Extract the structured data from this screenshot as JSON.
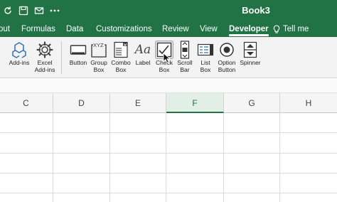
{
  "window": {
    "title": "Book3"
  },
  "menu": {
    "tabs": [
      "out",
      "Formulas",
      "Data",
      "Customizations",
      "Review",
      "View",
      "Developer"
    ],
    "active": "Developer",
    "tell_me": "Tell me"
  },
  "ribbon": {
    "addins": {
      "label": "Add-ins"
    },
    "excel_addins": {
      "label": "Excel\nAdd-ins"
    },
    "button": {
      "label": "Button"
    },
    "group_box": {
      "label": "Group\nBox",
      "icon_text": "XYZ"
    },
    "combo_box": {
      "label": "Combo\nBox"
    },
    "label": {
      "label": "Label",
      "icon_text": "Aa"
    },
    "check_box": {
      "label": "Check\nBox"
    },
    "scroll_bar": {
      "label": "Scroll\nBar"
    },
    "list_box": {
      "label": "List\nBox"
    },
    "option_button": {
      "label": "Option\nButton"
    },
    "spinner": {
      "label": "Spinner"
    }
  },
  "grid": {
    "columns": [
      "C",
      "D",
      "E",
      "F",
      "G",
      "H"
    ],
    "active_column": "F"
  },
  "colors": {
    "accent": "#217346"
  }
}
